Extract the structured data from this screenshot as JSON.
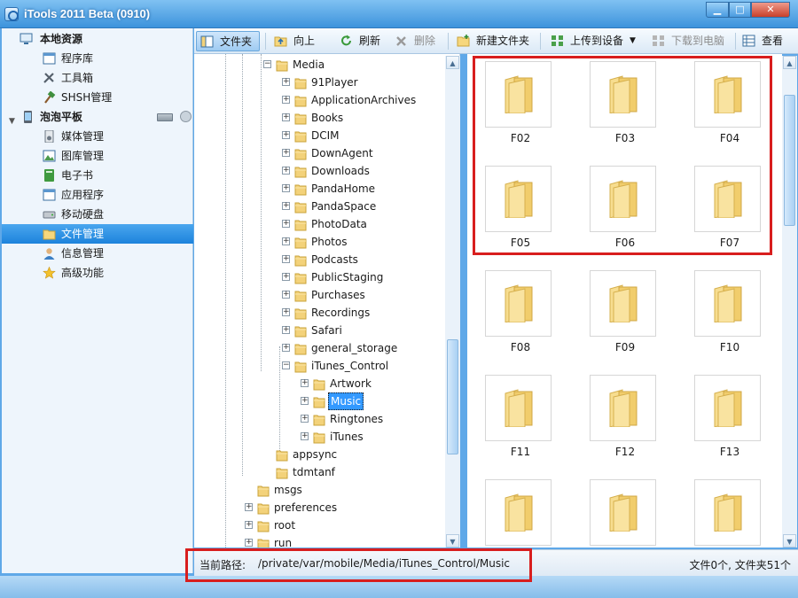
{
  "window": {
    "title": "iTools 2011 Beta (0910)",
    "controls": {
      "minimize": "▁",
      "maximize": "□",
      "close": "✕"
    }
  },
  "sidebar": {
    "sections": [
      {
        "label": "本地资源",
        "icon": "computer-icon"
      },
      {
        "label": "泡泡平板",
        "icon": "tablet-icon"
      }
    ],
    "local_items": [
      {
        "label": "程序库",
        "icon": "window-icon"
      },
      {
        "label": "工具箱",
        "icon": "tools-icon"
      },
      {
        "label": "SHSH管理",
        "icon": "hammer-icon"
      }
    ],
    "device_items": [
      {
        "label": "媒体管理",
        "icon": "media-icon"
      },
      {
        "label": "图库管理",
        "icon": "gallery-icon"
      },
      {
        "label": "电子书",
        "icon": "book-icon"
      },
      {
        "label": "应用程序",
        "icon": "app-icon"
      },
      {
        "label": "移动硬盘",
        "icon": "drive-icon"
      },
      {
        "label": "文件管理",
        "icon": "folder-icon"
      },
      {
        "label": "信息管理",
        "icon": "contact-icon"
      },
      {
        "label": "高级功能",
        "icon": "star-icon"
      }
    ],
    "selected": "文件管理"
  },
  "toolbar": {
    "folder": "文件夹",
    "up": "向上",
    "refresh": "刷新",
    "delete": "删除",
    "new_folder": "新建文件夹",
    "upload": "上传到设备",
    "download": "下载到电脑",
    "view": "查看"
  },
  "tree": {
    "media": "Media",
    "media_children": [
      "91Player",
      "ApplicationArchives",
      "Books",
      "DCIM",
      "DownAgent",
      "Downloads",
      "PandaHome",
      "PandaSpace",
      "PhotoData",
      "Photos",
      "Podcasts",
      "PublicStaging",
      "Purchases",
      "Recordings",
      "Safari",
      "general_storage",
      "iTunes_Control"
    ],
    "itunes_children": [
      "Artwork",
      "Music",
      "Ringtones",
      "iTunes"
    ],
    "selected": "Music",
    "after_media": [
      "appsync",
      "tdmtanf"
    ],
    "root_level": [
      "msgs",
      "preferences",
      "root",
      "run"
    ]
  },
  "files": {
    "folders": [
      "F02",
      "F03",
      "F04",
      "F05",
      "F06",
      "F07",
      "F08",
      "F09",
      "F10",
      "F11",
      "F12",
      "F13",
      "",
      "",
      ""
    ]
  },
  "status": {
    "path_label": "当前路径:",
    "path_value": "/private/var/mobile/Media/iTunes_Control/Music",
    "counts": "文件0个, 文件夹51个"
  },
  "colors": {
    "selection": "#1d83dc",
    "highlight_box": "#d81e1e",
    "folder": "#f3d27a"
  }
}
